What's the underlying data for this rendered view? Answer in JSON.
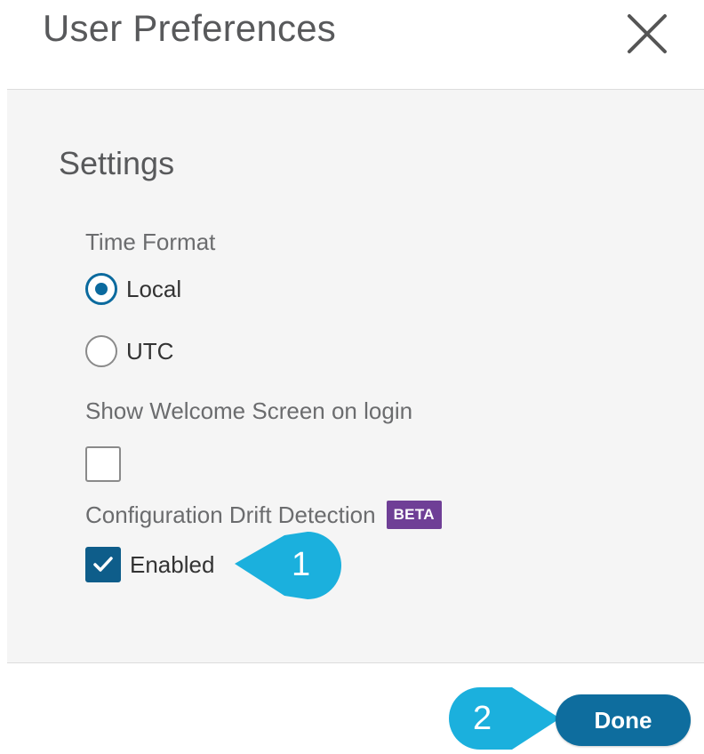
{
  "dialog": {
    "title": "User Preferences",
    "close_icon": "close-icon"
  },
  "settings": {
    "section_title": "Settings",
    "time_format": {
      "label": "Time Format",
      "options": [
        {
          "label": "Local",
          "selected": true
        },
        {
          "label": "UTC",
          "selected": false
        }
      ]
    },
    "welcome_screen": {
      "label": "Show Welcome Screen on login",
      "checked": false
    },
    "drift_detection": {
      "label": "Configuration Drift Detection",
      "badge": "BETA",
      "option_label": "Enabled",
      "checked": true
    }
  },
  "callouts": [
    {
      "number": "1"
    },
    {
      "number": "2"
    }
  ],
  "footer": {
    "done_label": "Done"
  },
  "colors": {
    "accent": "#0e6d9e",
    "beta_badge": "#6f3f96",
    "callout": "#1bb0dd",
    "panel_bg": "#f5f5f5"
  }
}
